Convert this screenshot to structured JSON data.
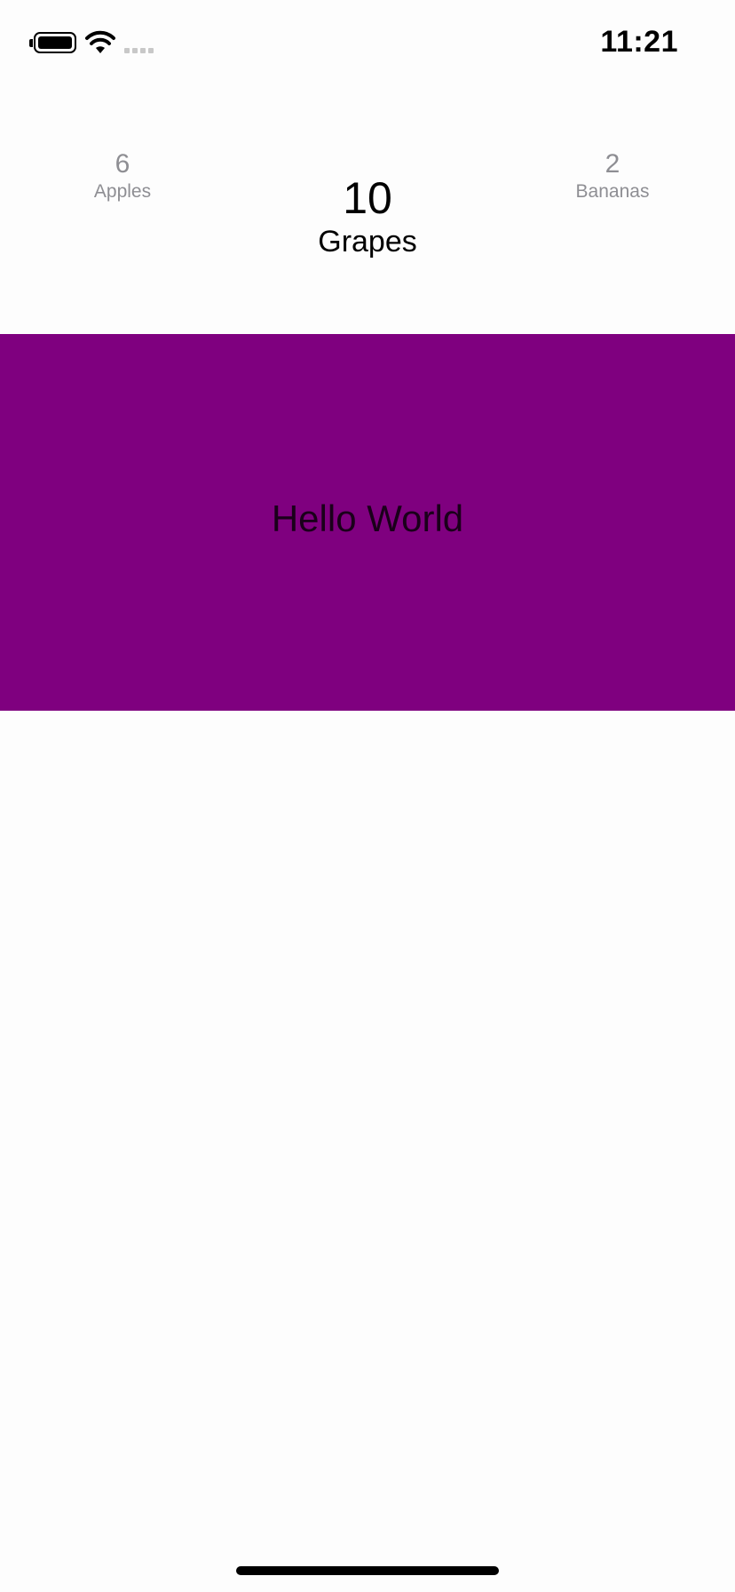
{
  "status_bar": {
    "time": "11:21",
    "battery_icon": "battery-full-icon",
    "wifi_icon": "wifi-icon",
    "signal_icon": "cellular-signal-icon"
  },
  "picker": {
    "items": [
      {
        "count": "6",
        "label": "Apples"
      },
      {
        "count": "10",
        "label": "Grapes"
      },
      {
        "count": "2",
        "label": "Bananas"
      }
    ],
    "selected": "Grapes"
  },
  "content": {
    "text": "Hello World",
    "background_color": "#7f007f"
  },
  "colors": {
    "inactive_text": "#8e8e93",
    "active_text": "#000000",
    "panel": "#7f007f"
  }
}
